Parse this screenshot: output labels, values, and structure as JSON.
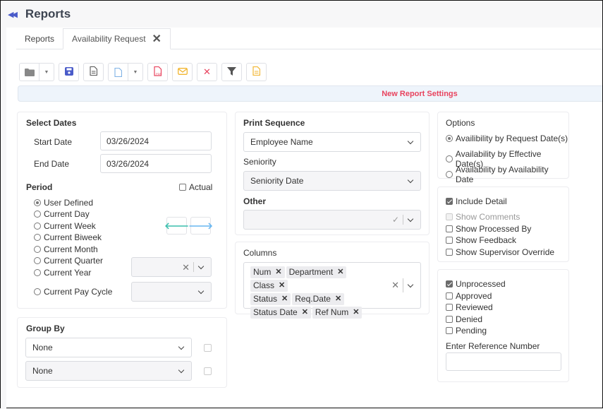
{
  "header": {
    "title": "Reports",
    "collapse_icon": "double-chevron-left-icon"
  },
  "tabs": [
    {
      "label": "Reports",
      "active": false
    },
    {
      "label": "Availability Request",
      "active": true,
      "closable": true
    }
  ],
  "toolbar": {
    "buttons": [
      {
        "name": "open-folder",
        "icon": "folder-icon",
        "has_dropdown": true
      },
      {
        "name": "save",
        "icon": "save-icon"
      },
      {
        "name": "view-report",
        "icon": "document-icon"
      },
      {
        "name": "new-report",
        "icon": "new-document-icon",
        "has_dropdown": true
      },
      {
        "name": "export-pdf",
        "icon": "pdf-icon"
      },
      {
        "name": "email",
        "icon": "envelope-icon"
      },
      {
        "name": "delete",
        "icon": "close-icon"
      },
      {
        "name": "filter",
        "icon": "filter-icon"
      },
      {
        "name": "notes",
        "icon": "note-icon"
      }
    ]
  },
  "banner": {
    "text": "New Report Settings",
    "color": "#e8435e"
  },
  "select_dates": {
    "title": "Select Dates",
    "start_label": "Start Date",
    "start_value": "03/26/2024",
    "end_label": "End Date",
    "end_value": "03/26/2024",
    "period_label": "Period",
    "actual_label": "Actual",
    "actual_checked": false,
    "period_options": [
      {
        "label": "User Defined",
        "selected": true
      },
      {
        "label": "Current Day",
        "selected": false
      },
      {
        "label": "Current Week",
        "selected": false
      },
      {
        "label": "Current Biweek",
        "selected": false
      },
      {
        "label": "Current Month",
        "selected": false
      },
      {
        "label": "Current Quarter",
        "selected": false
      },
      {
        "label": "Current Year",
        "selected": false
      },
      {
        "label": "Current Pay Cycle",
        "selected": false
      }
    ],
    "year_select_value": "",
    "pay_cycle_select_value": ""
  },
  "group_by": {
    "title": "Group By",
    "selects": [
      {
        "value": "None",
        "checked": false
      },
      {
        "value": "None",
        "checked": false
      }
    ]
  },
  "print_sequence": {
    "title": "Print Sequence",
    "value": "Employee Name",
    "seniority_label": "Seniority",
    "seniority_value": "Seniority Date",
    "other_label": "Other",
    "other_value": ""
  },
  "columns": {
    "title": "Columns",
    "tags": [
      "Num",
      "Department",
      "Class",
      "Status",
      "Req.Date",
      "Status Date",
      "Ref Num"
    ]
  },
  "options": {
    "title": "Options",
    "radios": [
      {
        "label": "Availibility by Request Date(s)",
        "selected": true
      },
      {
        "label": "Availability by Effective Date(s)",
        "selected": false
      },
      {
        "label": "Availability by Availability Date",
        "selected": false
      }
    ]
  },
  "detail": {
    "include_detail": {
      "label": "Include Detail",
      "checked": true
    },
    "items": [
      {
        "label": "Show Comments",
        "checked": false,
        "disabled": true
      },
      {
        "label": "Show Processed By",
        "checked": false
      },
      {
        "label": "Show Feedback",
        "checked": false
      },
      {
        "label": "Show Supervisor Override",
        "checked": false
      }
    ]
  },
  "status": {
    "items": [
      {
        "label": "Unprocessed",
        "checked": true
      },
      {
        "label": "Approved",
        "checked": false
      },
      {
        "label": "Reviewed",
        "checked": false
      },
      {
        "label": "Denied",
        "checked": false
      },
      {
        "label": "Pending",
        "checked": false
      }
    ],
    "ref_label": "Enter Reference Number",
    "ref_value": ""
  }
}
